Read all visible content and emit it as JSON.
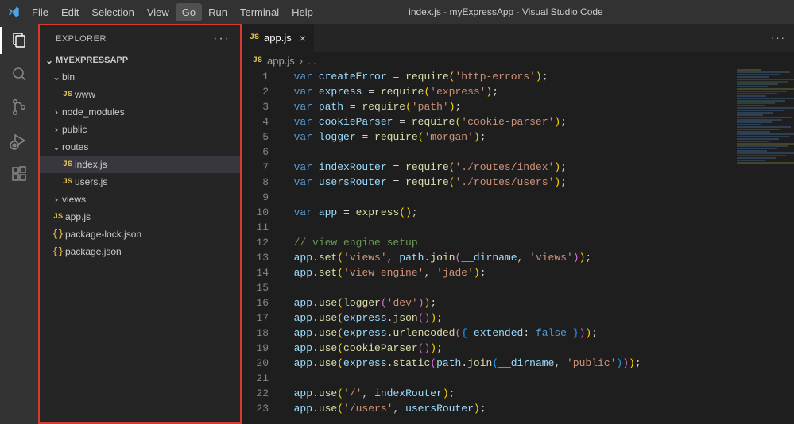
{
  "title": "index.js - myExpressApp - Visual Studio Code",
  "menu": [
    "File",
    "Edit",
    "Selection",
    "View",
    "Go",
    "Run",
    "Terminal",
    "Help"
  ],
  "menu_active_index": 4,
  "sidebar": {
    "title": "EXPLORER",
    "section": "MYEXPRESSAPP",
    "items": [
      {
        "type": "folder",
        "label": "bin",
        "depth": 1,
        "expanded": true
      },
      {
        "type": "file",
        "label": "www",
        "icon": "JS",
        "depth": 2
      },
      {
        "type": "folder",
        "label": "node_modules",
        "depth": 1,
        "expanded": false
      },
      {
        "type": "folder",
        "label": "public",
        "depth": 1,
        "expanded": false
      },
      {
        "type": "folder",
        "label": "routes",
        "depth": 1,
        "expanded": true
      },
      {
        "type": "file",
        "label": "index.js",
        "icon": "JS",
        "depth": 2,
        "selected": true
      },
      {
        "type": "file",
        "label": "users.js",
        "icon": "JS",
        "depth": 2
      },
      {
        "type": "folder",
        "label": "views",
        "depth": 1,
        "expanded": false
      },
      {
        "type": "file",
        "label": "app.js",
        "icon": "JS",
        "depth": 1
      },
      {
        "type": "file",
        "label": "package-lock.json",
        "icon": "{}",
        "depth": 1
      },
      {
        "type": "file",
        "label": "package.json",
        "icon": "{}",
        "depth": 1
      }
    ]
  },
  "tabs": [
    {
      "label": "app.js",
      "icon": "JS"
    }
  ],
  "breadcrumb": {
    "icon": "JS",
    "file": "app.js",
    "sep": "›",
    "rest": "..."
  },
  "code": {
    "start_line": 1,
    "lines": [
      [
        [
          "kw",
          "var"
        ],
        [
          "p",
          " "
        ],
        [
          "var",
          "createError"
        ],
        [
          "p",
          " = "
        ],
        [
          "fn",
          "require"
        ],
        [
          "yb",
          "("
        ],
        [
          "str",
          "'http-errors'"
        ],
        [
          "yb",
          ")"
        ],
        [
          "p",
          ";"
        ]
      ],
      [
        [
          "kw",
          "var"
        ],
        [
          "p",
          " "
        ],
        [
          "var",
          "express"
        ],
        [
          "p",
          " = "
        ],
        [
          "fn",
          "require"
        ],
        [
          "yb",
          "("
        ],
        [
          "str",
          "'express'"
        ],
        [
          "yb",
          ")"
        ],
        [
          "p",
          ";"
        ]
      ],
      [
        [
          "kw",
          "var"
        ],
        [
          "p",
          " "
        ],
        [
          "var",
          "path"
        ],
        [
          "p",
          " = "
        ],
        [
          "fn",
          "require"
        ],
        [
          "yb",
          "("
        ],
        [
          "str",
          "'path'"
        ],
        [
          "yb",
          ")"
        ],
        [
          "p",
          ";"
        ]
      ],
      [
        [
          "kw",
          "var"
        ],
        [
          "p",
          " "
        ],
        [
          "var",
          "cookieParser"
        ],
        [
          "p",
          " = "
        ],
        [
          "fn",
          "require"
        ],
        [
          "yb",
          "("
        ],
        [
          "str",
          "'cookie-parser'"
        ],
        [
          "yb",
          ")"
        ],
        [
          "p",
          ";"
        ]
      ],
      [
        [
          "kw",
          "var"
        ],
        [
          "p",
          " "
        ],
        [
          "var",
          "logger"
        ],
        [
          "p",
          " = "
        ],
        [
          "fn",
          "require"
        ],
        [
          "yb",
          "("
        ],
        [
          "str",
          "'morgan'"
        ],
        [
          "yb",
          ")"
        ],
        [
          "p",
          ";"
        ]
      ],
      [],
      [
        [
          "kw",
          "var"
        ],
        [
          "p",
          " "
        ],
        [
          "var",
          "indexRouter"
        ],
        [
          "p",
          " = "
        ],
        [
          "fn",
          "require"
        ],
        [
          "yb",
          "("
        ],
        [
          "str",
          "'./routes/index'"
        ],
        [
          "yb",
          ")"
        ],
        [
          "p",
          ";"
        ]
      ],
      [
        [
          "kw",
          "var"
        ],
        [
          "p",
          " "
        ],
        [
          "var",
          "usersRouter"
        ],
        [
          "p",
          " = "
        ],
        [
          "fn",
          "require"
        ],
        [
          "yb",
          "("
        ],
        [
          "str",
          "'./routes/users'"
        ],
        [
          "yb",
          ")"
        ],
        [
          "p",
          ";"
        ]
      ],
      [],
      [
        [
          "kw",
          "var"
        ],
        [
          "p",
          " "
        ],
        [
          "var",
          "app"
        ],
        [
          "p",
          " = "
        ],
        [
          "fn",
          "express"
        ],
        [
          "yb",
          "("
        ],
        [
          "yb",
          ")"
        ],
        [
          "p",
          ";"
        ]
      ],
      [],
      [
        [
          "com",
          "// view engine setup"
        ]
      ],
      [
        [
          "var",
          "app"
        ],
        [
          "p",
          "."
        ],
        [
          "fn",
          "set"
        ],
        [
          "yb",
          "("
        ],
        [
          "str",
          "'views'"
        ],
        [
          "p",
          ", "
        ],
        [
          "var",
          "path"
        ],
        [
          "p",
          "."
        ],
        [
          "fn",
          "join"
        ],
        [
          "pb",
          "("
        ],
        [
          "var",
          "__dirname"
        ],
        [
          "p",
          ", "
        ],
        [
          "str",
          "'views'"
        ],
        [
          "pb",
          ")"
        ],
        [
          "yb",
          ")"
        ],
        [
          "p",
          ";"
        ]
      ],
      [
        [
          "var",
          "app"
        ],
        [
          "p",
          "."
        ],
        [
          "fn",
          "set"
        ],
        [
          "yb",
          "("
        ],
        [
          "str",
          "'view engine'"
        ],
        [
          "p",
          ", "
        ],
        [
          "str",
          "'jade'"
        ],
        [
          "yb",
          ")"
        ],
        [
          "p",
          ";"
        ]
      ],
      [],
      [
        [
          "var",
          "app"
        ],
        [
          "p",
          "."
        ],
        [
          "fn",
          "use"
        ],
        [
          "yb",
          "("
        ],
        [
          "fn",
          "logger"
        ],
        [
          "pb",
          "("
        ],
        [
          "str",
          "'dev'"
        ],
        [
          "pb",
          ")"
        ],
        [
          "yb",
          ")"
        ],
        [
          "p",
          ";"
        ]
      ],
      [
        [
          "var",
          "app"
        ],
        [
          "p",
          "."
        ],
        [
          "fn",
          "use"
        ],
        [
          "yb",
          "("
        ],
        [
          "var",
          "express"
        ],
        [
          "p",
          "."
        ],
        [
          "fn",
          "json"
        ],
        [
          "pb",
          "("
        ],
        [
          "pb",
          ")"
        ],
        [
          "yb",
          ")"
        ],
        [
          "p",
          ";"
        ]
      ],
      [
        [
          "var",
          "app"
        ],
        [
          "p",
          "."
        ],
        [
          "fn",
          "use"
        ],
        [
          "yb",
          "("
        ],
        [
          "var",
          "express"
        ],
        [
          "p",
          "."
        ],
        [
          "fn",
          "urlencoded"
        ],
        [
          "pb",
          "("
        ],
        [
          "bb",
          "{"
        ],
        [
          "p",
          " "
        ],
        [
          "var",
          "extended"
        ],
        [
          "p",
          ":"
        ],
        [
          "p",
          " "
        ],
        [
          "kw",
          "false"
        ],
        [
          "p",
          " "
        ],
        [
          "bb",
          "}"
        ],
        [
          "pb",
          ")"
        ],
        [
          "yb",
          ")"
        ],
        [
          "p",
          ";"
        ]
      ],
      [
        [
          "var",
          "app"
        ],
        [
          "p",
          "."
        ],
        [
          "fn",
          "use"
        ],
        [
          "yb",
          "("
        ],
        [
          "fn",
          "cookieParser"
        ],
        [
          "pb",
          "("
        ],
        [
          "pb",
          ")"
        ],
        [
          "yb",
          ")"
        ],
        [
          "p",
          ";"
        ]
      ],
      [
        [
          "var",
          "app"
        ],
        [
          "p",
          "."
        ],
        [
          "fn",
          "use"
        ],
        [
          "yb",
          "("
        ],
        [
          "var",
          "express"
        ],
        [
          "p",
          "."
        ],
        [
          "fn",
          "static"
        ],
        [
          "pb",
          "("
        ],
        [
          "var",
          "path"
        ],
        [
          "p",
          "."
        ],
        [
          "fn",
          "join"
        ],
        [
          "bb",
          "("
        ],
        [
          "var",
          "__dirname"
        ],
        [
          "p",
          ", "
        ],
        [
          "str",
          "'public'"
        ],
        [
          "bb",
          ")"
        ],
        [
          "pb",
          ")"
        ],
        [
          "yb",
          ")"
        ],
        [
          "p",
          ";"
        ]
      ],
      [],
      [
        [
          "var",
          "app"
        ],
        [
          "p",
          "."
        ],
        [
          "fn",
          "use"
        ],
        [
          "yb",
          "("
        ],
        [
          "str",
          "'/'"
        ],
        [
          "p",
          ", "
        ],
        [
          "var",
          "indexRouter"
        ],
        [
          "yb",
          ")"
        ],
        [
          "p",
          ";"
        ]
      ],
      [
        [
          "var",
          "app"
        ],
        [
          "p",
          "."
        ],
        [
          "fn",
          "use"
        ],
        [
          "yb",
          "("
        ],
        [
          "str",
          "'/users'"
        ],
        [
          "p",
          ", "
        ],
        [
          "var",
          "usersRouter"
        ],
        [
          "yb",
          ")"
        ],
        [
          "p",
          ";"
        ]
      ]
    ]
  }
}
